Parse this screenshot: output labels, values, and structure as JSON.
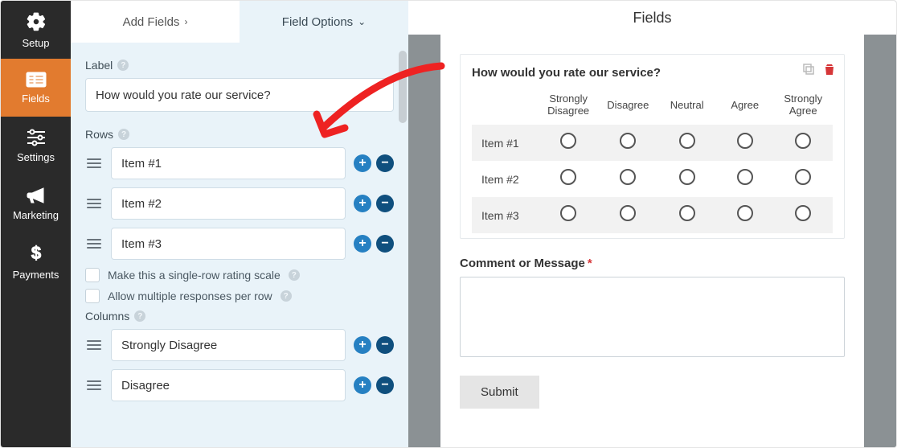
{
  "nav": {
    "setup": "Setup",
    "fields": "Fields",
    "settings": "Settings",
    "marketing": "Marketing",
    "payments": "Payments"
  },
  "header": {
    "title": "Fields"
  },
  "tabs": {
    "add_fields": "Add Fields",
    "field_options": "Field Options"
  },
  "options": {
    "label_heading": "Label",
    "label_value": "How would you rate our service?",
    "rows_heading": "Rows",
    "rows": [
      "Item #1",
      "Item #2",
      "Item #3"
    ],
    "single_row_label": "Make this a single-row rating scale",
    "multi_response_label": "Allow multiple responses per row",
    "columns_heading": "Columns",
    "columns_editable": [
      "Strongly Disagree",
      "Disagree"
    ]
  },
  "preview": {
    "field_title": "How would you rate our service?",
    "columns": [
      "Strongly Disagree",
      "Disagree",
      "Neutral",
      "Agree",
      "Strongly Agree"
    ],
    "rows": [
      "Item #1",
      "Item #2",
      "Item #3"
    ],
    "comment_label": "Comment or Message",
    "submit": "Submit"
  },
  "icons": {
    "duplicate": "duplicate-icon",
    "trash": "trash-icon"
  }
}
